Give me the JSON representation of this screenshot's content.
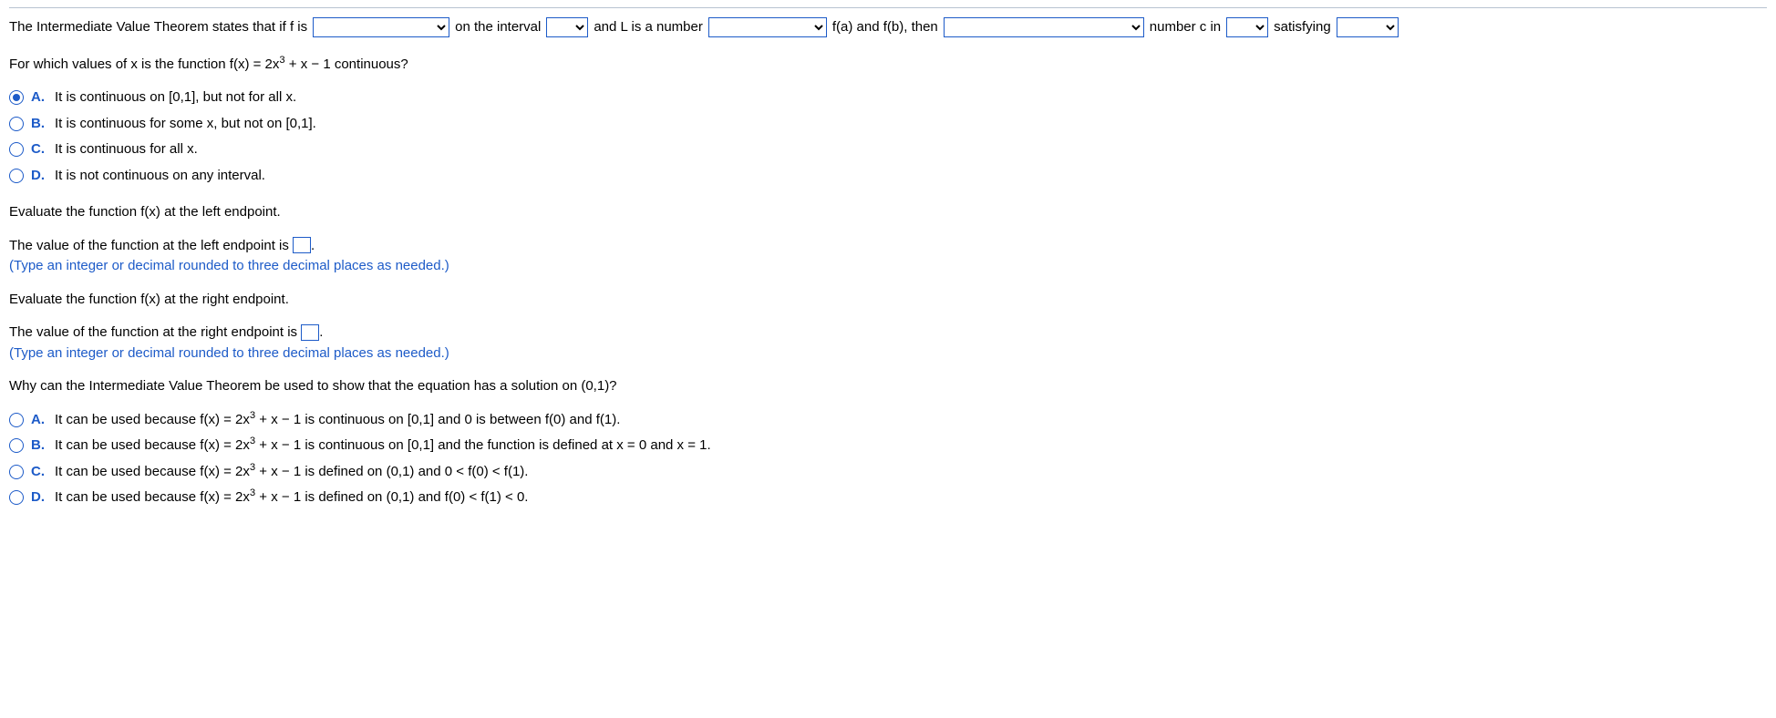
{
  "ivt": {
    "t1": "The Intermediate Value Theorem states that if f is",
    "t2": "on the interval",
    "t3": "and L is a number",
    "t4": "f(a) and f(b), then",
    "t5": "number c in",
    "t6": "satisfying"
  },
  "q1": {
    "prompt_pre": "For which values of x is the function f(x) = 2x",
    "prompt_sup": "3",
    "prompt_post": " + x − 1 continuous?",
    "options": {
      "A": "It is continuous on [0,1], but not for all x.",
      "B": "It is continuous for some x, but not on [0,1].",
      "C": "It is continuous for all x.",
      "D": "It is not continuous on any interval."
    }
  },
  "left_ep": {
    "prompt": "Evaluate the function f(x) at the left endpoint.",
    "stmt_pre": "The value of the function at the left endpoint is ",
    "stmt_post": ".",
    "hint": "(Type an integer or decimal rounded to three decimal places as needed.)"
  },
  "right_ep": {
    "prompt": "Evaluate the function f(x) at the right endpoint.",
    "stmt_pre": "The value of the function at the right endpoint is ",
    "stmt_post": ".",
    "hint": "(Type an integer or decimal rounded to three decimal places as needed.)"
  },
  "q2": {
    "prompt": "Why can the Intermediate Value Theorem be used to show that the equation has a solution on (0,1)?",
    "opts": {
      "A": {
        "pre": "It can be used because f(x) = 2x",
        "sup": "3",
        "post": " + x − 1 is continuous on [0,1] and 0 is between f(0) and f(1)."
      },
      "B": {
        "pre": "It can be used because f(x) = 2x",
        "sup": "3",
        "post": " + x − 1 is continuous on [0,1] and the function is defined at x = 0 and x = 1."
      },
      "C": {
        "pre": "It can be used because f(x) = 2x",
        "sup": "3",
        "post": " + x − 1 is defined on (0,1) and 0 < f(0) < f(1)."
      },
      "D": {
        "pre": "It can be used because f(x) = 2x",
        "sup": "3",
        "post": " + x − 1 is defined on (0,1) and f(0) < f(1) < 0."
      }
    }
  },
  "labels": {
    "A": "A.",
    "B": "B.",
    "C": "C.",
    "D": "D."
  }
}
